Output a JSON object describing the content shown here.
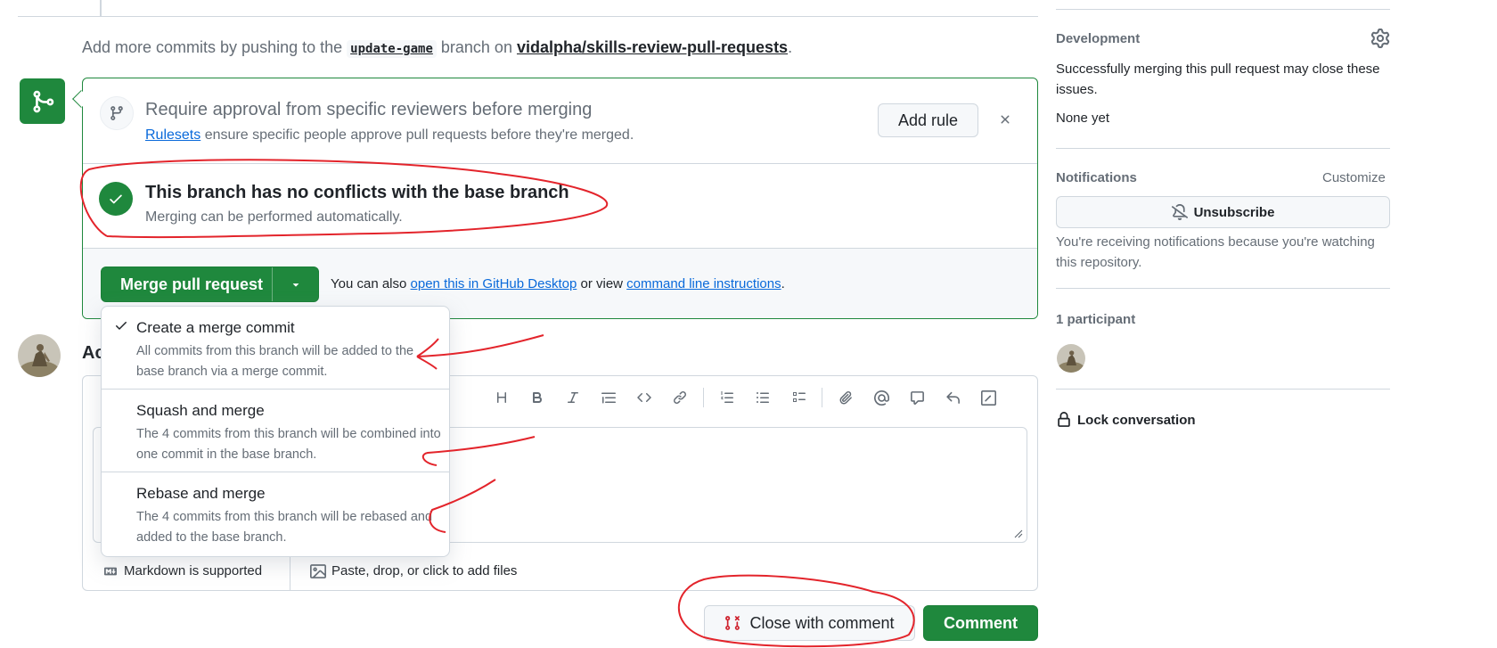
{
  "push_info": {
    "prefix": "Add more commits by pushing to the",
    "branch": "update-game",
    "middle": "branch on",
    "repo": "vidalpha/skills-review-pull-requests",
    "suffix": "."
  },
  "rules": {
    "title": "Require approval from specific reviewers before merging",
    "link": "Rulesets",
    "subtitle": "ensure specific people approve pull requests before they're merged.",
    "add_rule": "Add rule",
    "close": "×"
  },
  "conflicts": {
    "title": "This branch has no conflicts with the base branch",
    "subtitle": "Merging can be performed automatically."
  },
  "merge": {
    "button": "Merge pull request",
    "also_prefix": "You can also",
    "desktop_link": "open this in GitHub Desktop",
    "or_view": "or view",
    "cli_link": "command line instructions",
    "period": "."
  },
  "dropdown": [
    {
      "title": "Create a merge commit",
      "desc": "All commits from this branch will be added to the base branch via a merge commit.",
      "selected": true
    },
    {
      "title": "Squash and merge",
      "desc": "The 4 commits from this branch will be combined into one commit in the base branch.",
      "selected": false
    },
    {
      "title": "Rebase and merge",
      "desc": "The 4 commits from this branch will be rebased and added to the base branch.",
      "selected": false
    }
  ],
  "comment": {
    "label_visible": "Ac",
    "markdown": "Markdown is supported",
    "attach": "Paste, drop, or click to add files",
    "close_with_comment": "Close with comment",
    "comment_button": "Comment"
  },
  "sidebar": {
    "development": {
      "heading": "Development",
      "text": "Successfully merging this pull request may close these issues.",
      "none": "None yet"
    },
    "notifications": {
      "heading": "Notifications",
      "customize": "Customize",
      "unsubscribe": "Unsubscribe",
      "reason": "You're receiving notifications because you're watching this repository."
    },
    "participants": {
      "heading": "1 participant"
    },
    "lock": "Lock conversation"
  },
  "colors": {
    "accent_green": "#1f883d",
    "link_blue": "#0969da",
    "annotation_red": "#e3242b"
  },
  "icons": [
    "git-merge-icon",
    "git-branch-icon",
    "check-icon",
    "triangle-down-icon",
    "x-icon",
    "gear-icon",
    "bell-slash-icon",
    "lock-icon",
    "markdown-icon",
    "image-icon",
    "git-pull-request-closed-icon"
  ]
}
